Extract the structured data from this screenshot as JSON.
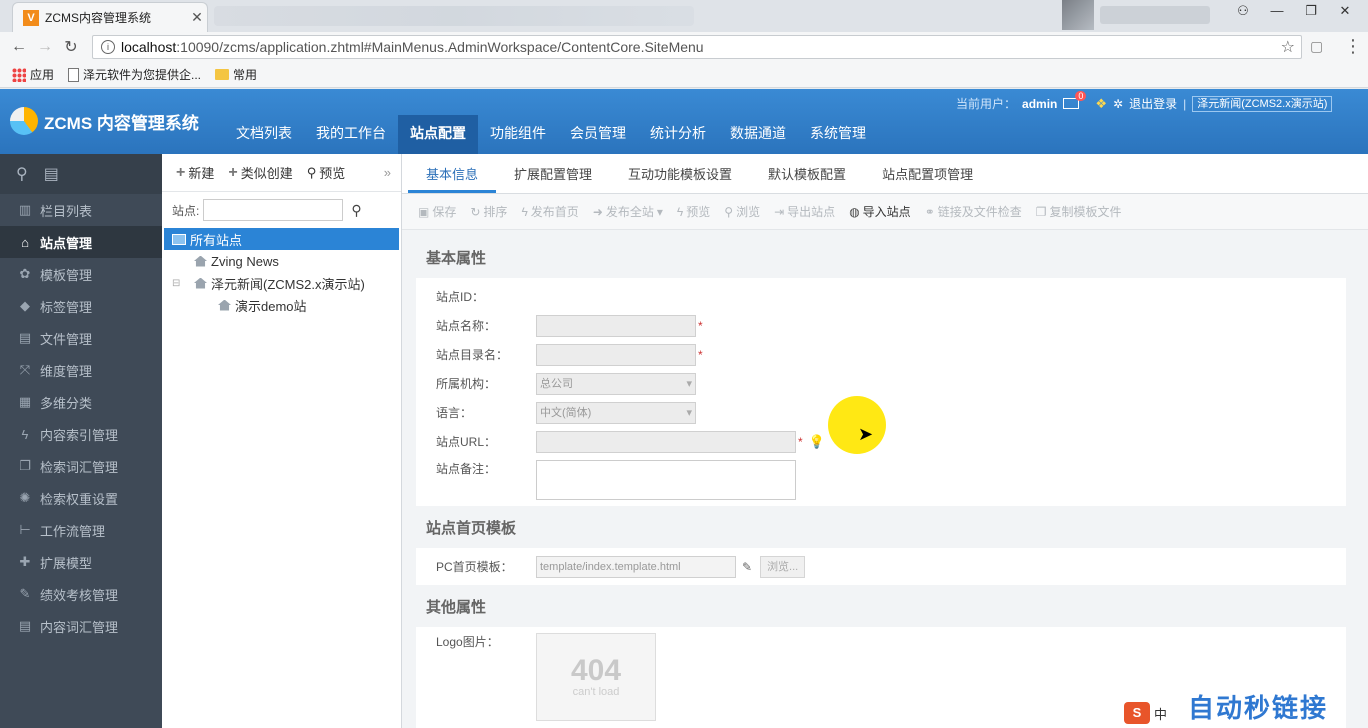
{
  "browser": {
    "tab_title": "ZCMS内容管理系统",
    "favicon_text": "V",
    "url_host": "localhost",
    "url_rest": ":10090/zcms/application.zhtml#MainMenus.AdminWorkspace/ContentCore.SiteMenu",
    "bookmarks": [
      "应用",
      "泽元软件为您提供企...",
      "常用"
    ]
  },
  "app": {
    "logo_text": "ZCMS 内容管理系统",
    "nav": [
      "文档列表",
      "我的工作台",
      "站点配置",
      "功能组件",
      "会员管理",
      "统计分析",
      "数据通道",
      "系统管理"
    ],
    "user_prefix": "当前用户：",
    "user_name": "admin",
    "mail_count": "0",
    "logout": "退出登录",
    "site_select": "泽元新闻(ZCMS2.x演示站)"
  },
  "sidebar": {
    "items": [
      "栏目列表",
      "站点管理",
      "模板管理",
      "标签管理",
      "文件管理",
      "维度管理",
      "多维分类",
      "内容索引管理",
      "检索词汇管理",
      "检索权重设置",
      "工作流管理",
      "扩展模型",
      "绩效考核管理",
      "内容词汇管理"
    ]
  },
  "tree": {
    "toolbar": [
      "新建",
      "类似创建",
      "预览"
    ],
    "search_label": "站点:",
    "nodes": [
      "所有站点",
      "Zving News",
      "泽元新闻(ZCMS2.x演示站)",
      "演示demo站"
    ]
  },
  "main": {
    "tabs": [
      "基本信息",
      "扩展配置管理",
      "互动功能模板设置",
      "默认模板配置",
      "站点配置项管理"
    ],
    "actions": [
      "保存",
      "排序",
      "发布首页",
      "发布全站",
      "预览",
      "浏览",
      "导出站点",
      "导入站点",
      "链接及文件检查",
      "复制模板文件"
    ],
    "section_basic": "基本属性",
    "fields": {
      "site_id": "站点ID：",
      "site_name": "站点名称：",
      "site_dir": "站点目录名：",
      "org": "所属机构：",
      "org_value": "总公司",
      "lang": "语言：",
      "lang_value": "中文(简体)",
      "site_url": "站点URL：",
      "site_note": "站点备注："
    },
    "section_home": "站点首页模板",
    "pc_template_label": "PC首页模板：",
    "pc_template_value": "template/index.template.html",
    "browse_label": "浏览...",
    "section_other": "其他属性",
    "logo_label": "Logo图片：",
    "logo_placeholder_big": "404",
    "logo_placeholder_small": "can't load"
  },
  "watermark": "自动秒链接",
  "ime_text": "中"
}
